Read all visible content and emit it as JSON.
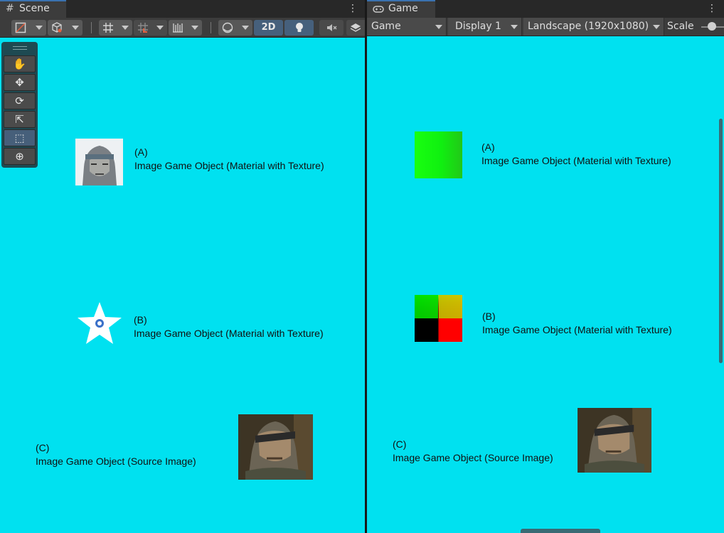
{
  "scene": {
    "tab": {
      "label": "Scene",
      "icon": "grid-hash-icon"
    },
    "menu_icon": "kebab-icon",
    "toolbar": {
      "buttons": [
        {
          "name": "draw-mode-dropdown",
          "icon": "shaded-square-icon"
        },
        {
          "name": "render-mode-dropdown",
          "icon": "cube-icon"
        },
        {
          "name": "grid-snap-dropdown",
          "icon": "grid-icon"
        },
        {
          "name": "increment-snap-dropdown",
          "icon": "magnet-grid-icon"
        },
        {
          "name": "ruler-dropdown",
          "icon": "ruler-icon"
        },
        {
          "name": "gizmos-dropdown",
          "icon": "sphere-icon"
        },
        {
          "name": "2d-toggle",
          "label": "2D"
        },
        {
          "name": "lighting-toggle",
          "icon": "lightbulb-icon"
        },
        {
          "name": "audio-toggle",
          "icon": "mute-icon"
        },
        {
          "name": "effects-toggle",
          "icon": "layers-icon"
        }
      ]
    },
    "tools": [
      {
        "name": "hand-tool",
        "icon": "hand-icon",
        "active": false
      },
      {
        "name": "move-tool",
        "icon": "move-arrows-icon",
        "active": false
      },
      {
        "name": "rotate-tool",
        "icon": "rotate-icon",
        "active": false
      },
      {
        "name": "scale-tool",
        "icon": "scale-icon",
        "active": false
      },
      {
        "name": "rect-tool",
        "icon": "rect-transform-icon",
        "active": true
      },
      {
        "name": "transform-tool",
        "icon": "transform-icon",
        "active": false
      }
    ],
    "objects": [
      {
        "tag": "(A)",
        "text": "Image Game Object (Material with Texture)"
      },
      {
        "tag": "(B)",
        "text": "Image Game Object (Material with Texture)"
      },
      {
        "tag": "(C)",
        "text": "Image Game Object (Source Image)"
      }
    ]
  },
  "game": {
    "tab": {
      "label": "Game",
      "icon": "gamepad-icon"
    },
    "menu_icon": "kebab-icon",
    "toolbar": {
      "view_select": "Game",
      "display_select": "Display 1",
      "resolution_select": "Landscape (1920x1080)",
      "scale_label": "Scale"
    },
    "objects": [
      {
        "tag": "(A)",
        "text": "Game Object (Material with Texture)"
      },
      {
        "tag": "(B)",
        "text": "Image Game Object (Material with Texture)"
      },
      {
        "tag": "(C)",
        "text": "Image Game Object (Source Image)"
      }
    ]
  },
  "colors": {
    "viewport_bg": "#00e1f0",
    "panel_bg": "#3c3c3c",
    "accent": "#3a72b0",
    "tool_panel": "#1e4a52"
  }
}
